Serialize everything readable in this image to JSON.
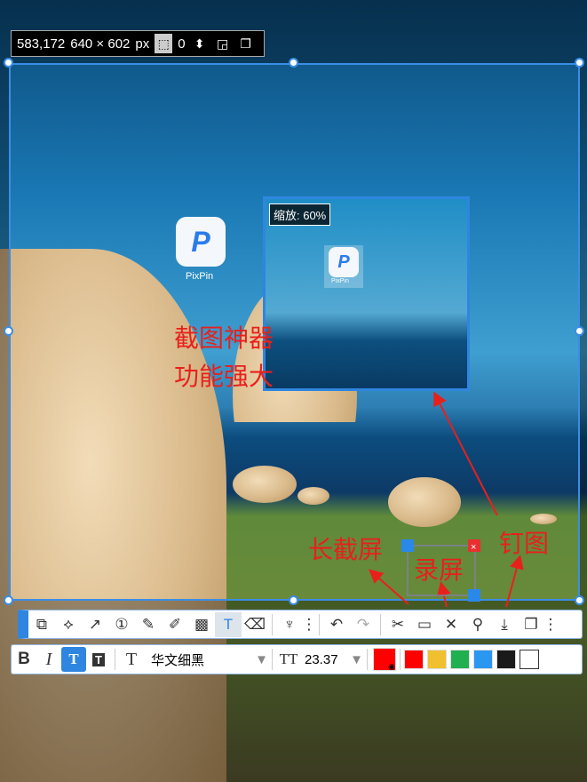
{
  "info_bar": {
    "position": "583,172",
    "size": "640 × 602",
    "unit": "px",
    "radius": "0"
  },
  "preview": {
    "zoom_label": "缩放: 60%",
    "app_label": "PixPin"
  },
  "desktop_icon": {
    "label": "PixPin",
    "glyph": "P"
  },
  "annotations": {
    "line1": "截图神器",
    "line2": "功能强大",
    "long_screenshot": "长截屏",
    "record": "录屏",
    "pin": "钉图"
  },
  "toolbar": {
    "tools": [
      "rectangle-ellipse",
      "polyline",
      "arrow",
      "number-marker",
      "pencil",
      "marker",
      "mosaic",
      "text",
      "eraser",
      "highlight",
      "more"
    ],
    "actions": [
      "undo",
      "redo",
      "long-screenshot",
      "record",
      "close",
      "pin",
      "save",
      "copy",
      "more"
    ]
  },
  "text_toolbar": {
    "bold": "B",
    "italic": "I",
    "font_icon": "T",
    "font_name": "华文细黑",
    "size_icon": "TT",
    "font_size": "23.37"
  },
  "colors": {
    "selected": "#ff0000",
    "swatches": [
      "#ff0000",
      "#f0c030",
      "#20b050",
      "#2a98f0",
      "#1a1a1a",
      "#ffffff"
    ]
  }
}
